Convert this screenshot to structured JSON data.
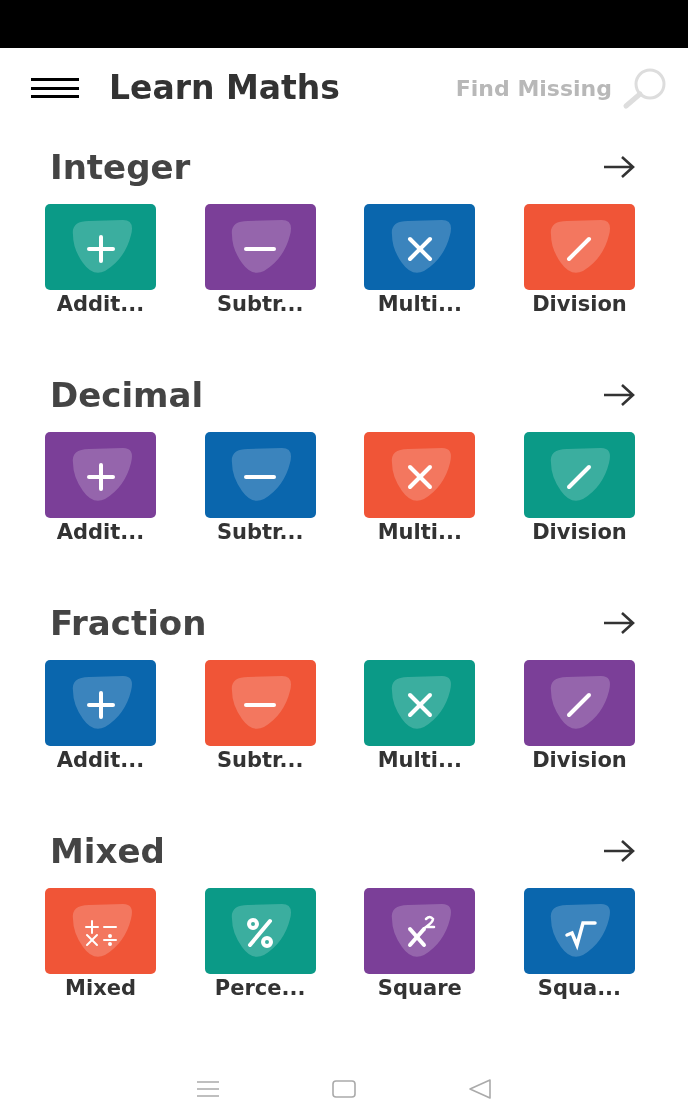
{
  "header": {
    "title": "Learn Maths",
    "search_placeholder": "Find Missing"
  },
  "sections": [
    {
      "title": "Integer",
      "items": [
        {
          "label": "Addit...",
          "color": "#0b9a87",
          "kind": "plus"
        },
        {
          "label": "Subtr...",
          "color": "#7b3f98",
          "kind": "minus"
        },
        {
          "label": "Multi...",
          "color": "#0a66ad",
          "kind": "times"
        },
        {
          "label": "Division",
          "color": "#f05537",
          "kind": "divide"
        }
      ]
    },
    {
      "title": "Decimal",
      "items": [
        {
          "label": "Addit...",
          "color": "#7b3f98",
          "kind": "plus"
        },
        {
          "label": "Subtr...",
          "color": "#0a66ad",
          "kind": "minus"
        },
        {
          "label": "Multi...",
          "color": "#f05537",
          "kind": "times"
        },
        {
          "label": "Division",
          "color": "#0b9a87",
          "kind": "divide"
        }
      ]
    },
    {
      "title": "Fraction",
      "items": [
        {
          "label": "Addit...",
          "color": "#0a66ad",
          "kind": "plus"
        },
        {
          "label": "Subtr...",
          "color": "#f05537",
          "kind": "minus"
        },
        {
          "label": "Multi...",
          "color": "#0b9a87",
          "kind": "times"
        },
        {
          "label": "Division",
          "color": "#7b3f98",
          "kind": "divide"
        }
      ]
    },
    {
      "title": "Mixed",
      "items": [
        {
          "label": "Mixed",
          "color": "#f05537",
          "kind": "mixed"
        },
        {
          "label": "Perce...",
          "color": "#0b9a87",
          "kind": "percent"
        },
        {
          "label": "Square",
          "color": "#7b3f98",
          "kind": "square"
        },
        {
          "label": "Squa...",
          "color": "#0a66ad",
          "kind": "root"
        }
      ]
    }
  ]
}
